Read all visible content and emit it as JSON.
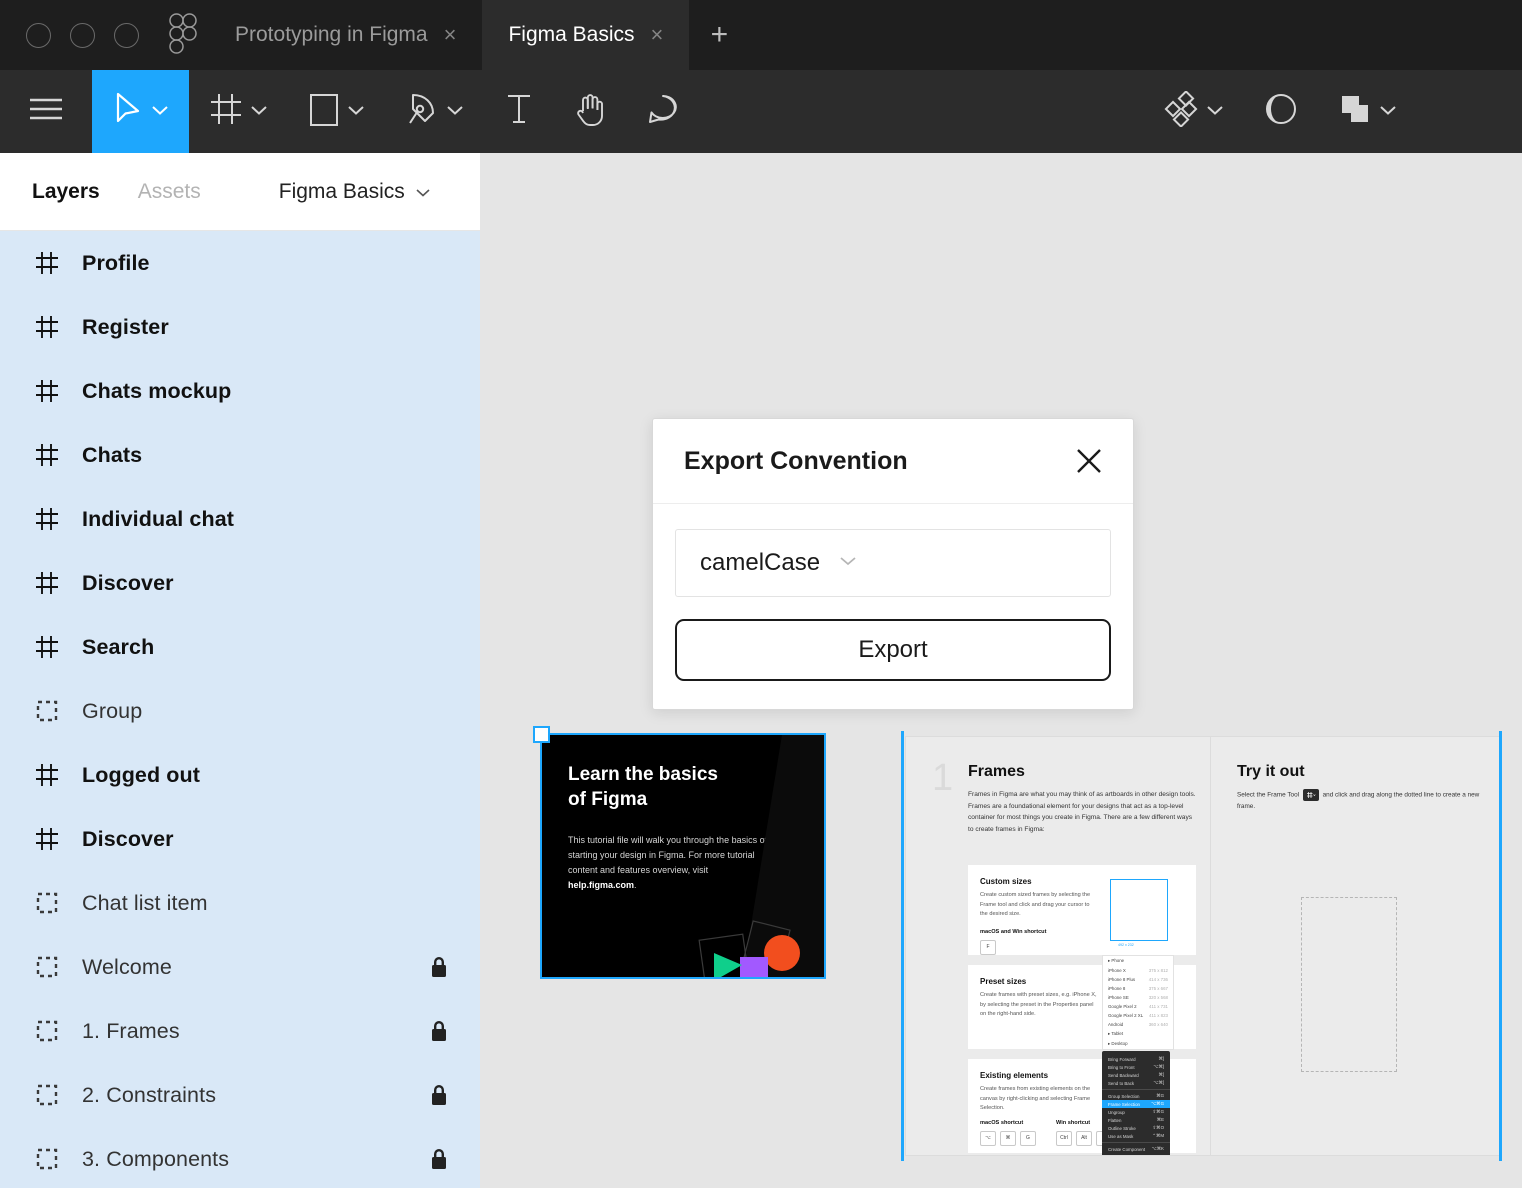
{
  "window": {
    "controls": [
      "close-circle",
      "minimize-circle",
      "maximize-circle"
    ],
    "logo": "figma-logo",
    "tabs": [
      {
        "label": "Prototyping in Figma",
        "active": false,
        "close": "×"
      },
      {
        "label": "Figma Basics",
        "active": true,
        "close": "×"
      }
    ],
    "add_tab": "+"
  },
  "toolbar": {
    "left": [
      {
        "name": "menu-icon",
        "icon": "hamburger",
        "chevron": false,
        "active": false
      },
      {
        "name": "move-tool",
        "icon": "cursor",
        "chevron": true,
        "active": true
      },
      {
        "name": "frame-tool",
        "icon": "frame",
        "chevron": true,
        "active": false
      },
      {
        "name": "shape-tool",
        "icon": "rectangle",
        "chevron": true,
        "active": false
      },
      {
        "name": "pen-tool",
        "icon": "pen",
        "chevron": true,
        "active": false
      },
      {
        "name": "text-tool",
        "icon": "text",
        "chevron": false,
        "active": false
      },
      {
        "name": "hand-tool",
        "icon": "hand",
        "chevron": false,
        "active": false
      },
      {
        "name": "comment-tool",
        "icon": "comment",
        "chevron": false,
        "active": false
      }
    ],
    "right": [
      {
        "name": "components-icon",
        "icon": "components",
        "chevron": true
      },
      {
        "name": "mask-icon",
        "icon": "mask",
        "chevron": false
      },
      {
        "name": "boolean-icon",
        "icon": "boolean",
        "chevron": true
      }
    ]
  },
  "sidebar": {
    "tabs": [
      {
        "label": "Layers",
        "active": true
      },
      {
        "label": "Assets",
        "active": false
      }
    ],
    "page_name": "Figma Basics",
    "layers": [
      {
        "name": "Profile",
        "type": "frame",
        "locked": false
      },
      {
        "name": "Register",
        "type": "frame",
        "locked": false
      },
      {
        "name": "Chats mockup",
        "type": "frame",
        "locked": false
      },
      {
        "name": "Chats",
        "type": "frame",
        "locked": false
      },
      {
        "name": "Individual chat",
        "type": "frame",
        "locked": false
      },
      {
        "name": "Discover",
        "type": "frame",
        "locked": false
      },
      {
        "name": "Search",
        "type": "frame",
        "locked": false
      },
      {
        "name": "Group",
        "type": "group",
        "locked": false
      },
      {
        "name": "Logged out",
        "type": "frame",
        "locked": false
      },
      {
        "name": "Discover",
        "type": "frame",
        "locked": false
      },
      {
        "name": "Chat list item",
        "type": "group",
        "locked": false
      },
      {
        "name": "Welcome",
        "type": "group",
        "locked": true
      },
      {
        "name": "1. Frames",
        "type": "group",
        "locked": true
      },
      {
        "name": "2. Constraints",
        "type": "group",
        "locked": true
      },
      {
        "name": "3. Components",
        "type": "group",
        "locked": true
      }
    ]
  },
  "modal": {
    "title": "Export Convention",
    "close_label": "✕",
    "select_value": "camelCase",
    "export_label": "Export"
  },
  "canvas": {
    "cover": {
      "title_line1": "Learn the basics",
      "title_line2": "of Figma",
      "body_prefix": "This tutorial file will walk you through the basics of starting your design in Figma. For more tutorial content and features overview, visit ",
      "body_link": "help.figma.com",
      "body_suffix": "."
    },
    "frames_page": {
      "number": "1",
      "title": "Frames",
      "description": "Frames in Figma are what you may think of as artboards in other design tools. Frames are a foundational element for your designs that act as a top-level container for most things you create in Figma. There are a few different ways to create frames in Figma:",
      "cards": [
        {
          "title": "Custom sizes",
          "description": "Create custom sized frames by selecting the Frame tool and click and drag your cursor to the desired size.",
          "shortcut_label": "macOS and Win shortcut",
          "keys": [
            "F"
          ],
          "frame_size_label": "492 x 232"
        },
        {
          "title": "Preset sizes",
          "description": "Create frames with preset sizes, e.g. iPhone X, by selecting the preset in the Properties panel on the right-hand side.",
          "presets_group": "Phone",
          "presets": [
            {
              "label": "iPhone X",
              "size": "375 x 812"
            },
            {
              "label": "iPhone 8 Plus",
              "size": "414 x 736"
            },
            {
              "label": "iPhone 8",
              "size": "375 x 667"
            },
            {
              "label": "iPhone SE",
              "size": "320 x 568"
            },
            {
              "label": "Google Pixel 2",
              "size": "411 x 731"
            },
            {
              "label": "Google Pixel 2 XL",
              "size": "411 x 823"
            },
            {
              "label": "Android",
              "size": "360 x 640"
            }
          ],
          "groups_after": [
            "Tablet",
            "Desktop"
          ]
        },
        {
          "title": "Existing elements",
          "description": "Create frames from existing elements on the canvas by right-clicking and selecting Frame Selection.",
          "mac_label": "macOS shortcut",
          "win_label": "Win shortcut",
          "mac_keys": [
            "⌥",
            "⌘",
            "G"
          ],
          "win_keys": [
            "Ctrl",
            "Alt",
            "G"
          ],
          "menu_items": [
            {
              "label": "Bring Forward",
              "shortcut": "⌘]"
            },
            {
              "label": "Bring to Front",
              "shortcut": "⌥⌘]"
            },
            {
              "label": "Send Backward",
              "shortcut": "⌘["
            },
            {
              "label": "Send to Back",
              "shortcut": "⌥⌘["
            },
            {
              "label": "Group Selection",
              "shortcut": "⌘G"
            },
            {
              "label": "Frame Selection",
              "shortcut": "⌥⌘G",
              "highlighted": true
            },
            {
              "label": "Ungroup",
              "shortcut": "⇧⌘G"
            },
            {
              "label": "Flatten",
              "shortcut": "⌘E"
            },
            {
              "label": "Outline Stroke",
              "shortcut": "⇧⌘O"
            },
            {
              "label": "Use as Mask",
              "shortcut": "⌃⌘M"
            },
            {
              "label": "Create Component",
              "shortcut": "⌥⌘K"
            }
          ]
        }
      ]
    },
    "try_page": {
      "title": "Try it out",
      "desc_before": "Select the Frame Tool",
      "badge": "frame-tool-icon",
      "desc_after": "and click and drag along the dotted line to create a new frame."
    }
  },
  "colors": {
    "accent": "#1ea7fd",
    "titlebar": "#1e1e1e",
    "toolbar": "#2c2c2c",
    "selection": "#d9e8f7",
    "canvas": "#e5e5e5"
  }
}
